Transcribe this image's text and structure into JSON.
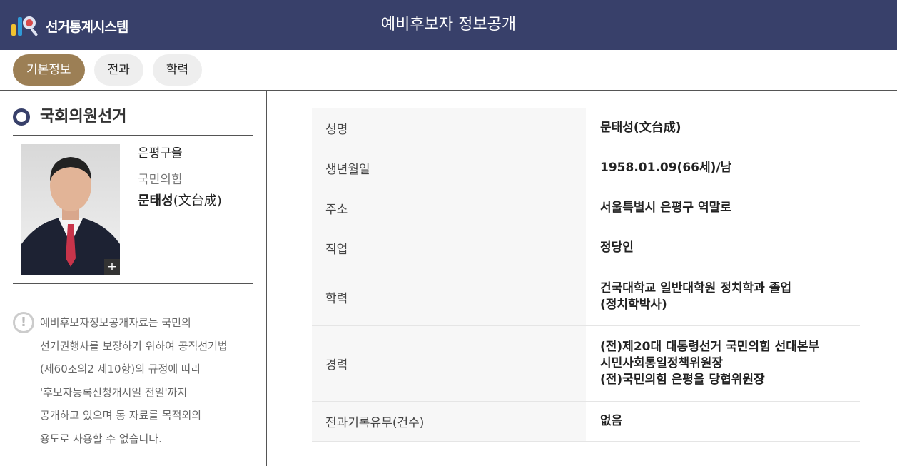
{
  "header": {
    "logo_text": "선거통계시스템",
    "title": "예비후보자 정보공개"
  },
  "tabs": [
    {
      "label": "기본정보",
      "active": true
    },
    {
      "label": "전과",
      "active": false
    },
    {
      "label": "학력",
      "active": false
    }
  ],
  "election": {
    "title": "국회의원선거"
  },
  "candidate": {
    "region": "은평구을",
    "party": "국민의힘",
    "name_korean": "문태성",
    "name_hanja": "(文台成)"
  },
  "notice": {
    "lines": [
      "예비후보자정보공개자료는 국민의",
      "선거권행사를 보장하기 위하여 공직선거법",
      "(제60조의2 제10항)의 규정에 따라",
      "'후보자등록신청개시일 전일'까지",
      "공개하고 있으며 동 자료를 목적외의",
      "용도로 사용할 수 없습니다."
    ]
  },
  "info_table": {
    "rows": [
      {
        "label": "성명",
        "lines": [
          "문태성(文台成)"
        ]
      },
      {
        "label": "생년월일",
        "lines": [
          "1958.01.09(66세)/남"
        ]
      },
      {
        "label": "주소",
        "lines": [
          "서울특별시 은평구 역말로"
        ]
      },
      {
        "label": "직업",
        "lines": [
          "정당인"
        ]
      },
      {
        "label": "학력",
        "lines": [
          "건국대학교 일반대학원 정치학과 졸업",
          "(정치학박사)"
        ]
      },
      {
        "label": "경력",
        "lines": [
          "(전)제20대 대통령선거 국민의힘 선대본부",
          "시민사회통일정책위원장",
          "(전)국민의힘 은평을 당협위원장"
        ]
      },
      {
        "label": "전과기록유무(건수)",
        "lines": [
          "없음"
        ]
      }
    ]
  },
  "colors": {
    "header_bg": "#38406a",
    "active_tab": "#9c7f55",
    "inactive_tab": "#eeeeee"
  },
  "icons": {
    "logo": "chart-magnifier-icon",
    "election": "circle-icon",
    "notice": "exclamation-icon",
    "photo_expand": "plus-icon"
  }
}
